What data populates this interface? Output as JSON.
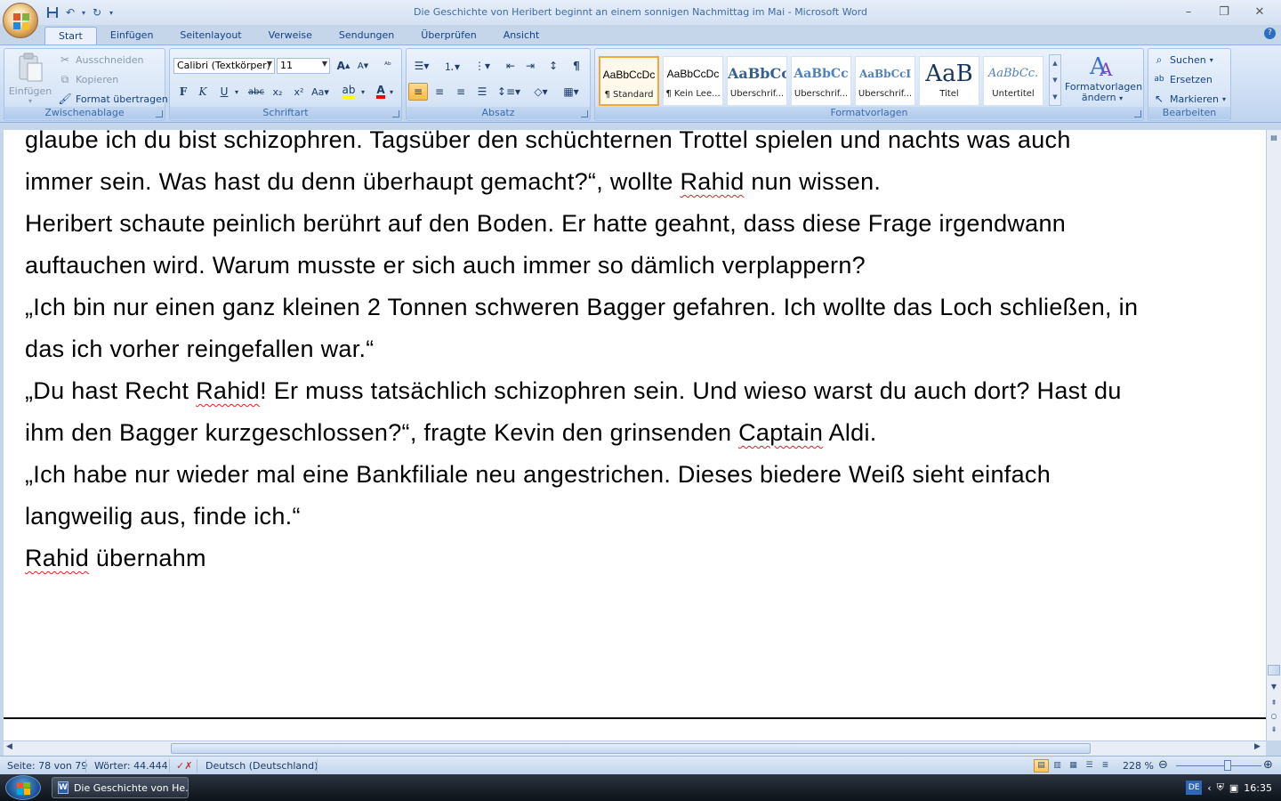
{
  "window": {
    "title": "Die Geschichte von Heribert beginnt an einem sonnigen Nachmittag im Mai - Microsoft Word"
  },
  "ribbon": {
    "tabs": [
      "Start",
      "Einfügen",
      "Seitenlayout",
      "Verweise",
      "Sendungen",
      "Überprüfen",
      "Ansicht"
    ],
    "active_tab": "Start",
    "clipboard": {
      "label": "Zwischenablage",
      "paste": "Einfügen",
      "cut": "Ausschneiden",
      "copy": "Kopieren",
      "format_painter": "Format übertragen"
    },
    "font": {
      "label": "Schriftart",
      "font_name": "Calibri (Textkörper)",
      "font_size": "11"
    },
    "paragraph": {
      "label": "Absatz"
    },
    "styles": {
      "label": "Formatvorlagen",
      "items": [
        {
          "sample": "AaBbCcDc",
          "name": "¶ Standard"
        },
        {
          "sample": "AaBbCcDc",
          "name": "¶ Kein Lee..."
        },
        {
          "sample": "AaBbCc",
          "name": "Überschrif..."
        },
        {
          "sample": "AaBbCc",
          "name": "Überschrif..."
        },
        {
          "sample": "AaBbCcI",
          "name": "Überschrif..."
        },
        {
          "sample": "AaB",
          "name": "Titel"
        },
        {
          "sample": "AaBbCc.",
          "name": "Untertitel"
        }
      ],
      "change_line1": "Formatvorlagen",
      "change_line2": "ändern"
    },
    "editing": {
      "label": "Bearbeiten",
      "find": "Suchen",
      "replace": "Ersetzen",
      "select": "Markieren"
    }
  },
  "document": {
    "lines": [
      [
        "glaube ich du bist schizophren. Tagsüber den schüchternen Trottel spielen und nachts was auch"
      ],
      [
        "immer sein. Was hast du denn überhaupt gemacht?“, wollte ",
        {
          "sp": "Rahid"
        },
        " nun wissen."
      ],
      [
        "Heribert schaute peinlich berührt auf den Boden. Er hatte geahnt, dass diese Frage irgendwann"
      ],
      [
        "auftauchen wird. Warum musste er sich auch immer so dämlich verplappern?"
      ],
      [
        "„Ich bin nur einen ganz kleinen 2 Tonnen schweren Bagger gefahren. Ich wollte das Loch schließen, in"
      ],
      [
        "das ich vorher reingefallen war.“"
      ],
      [
        "„Du hast Recht ",
        {
          "sp": "Rahid"
        },
        "! Er muss tatsächlich schizophren sein. Und wieso warst du auch dort? Hast du"
      ],
      [
        "ihm den Bagger kurzgeschlossen?“, fragte Kevin den grinsenden ",
        {
          "sp": "Captain"
        },
        " Aldi."
      ],
      [
        "„Ich habe nur wieder mal eine Bankfiliale neu angestrichen. Dieses biedere Weiß sieht einfach"
      ],
      [
        "langweilig aus, finde ich.“"
      ],
      [
        {
          "sp": "Rahid"
        },
        " übernahm"
      ]
    ]
  },
  "statusbar": {
    "page": "Seite: 78 von 79",
    "words": "Wörter: 44.444",
    "language": "Deutsch (Deutschland)",
    "zoom": "228 %",
    "zoom_level_percent": 228
  },
  "taskbar": {
    "task_label": "Die Geschichte von He...",
    "language_indicator": "DE",
    "clock": "16:35"
  }
}
